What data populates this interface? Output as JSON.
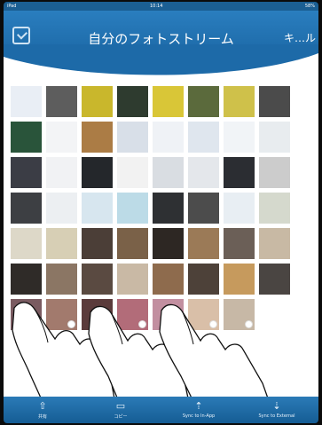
{
  "status_bar": {
    "carrier": "iPad",
    "time": "10:14",
    "battery": "58%"
  },
  "nav": {
    "title": "自分のフォトストリーム",
    "right_label": "キ…ル"
  },
  "thumbnails": [
    [
      "#e9eef5",
      "#5d5d5d",
      "#c9b72c",
      "#2e3b2f",
      "#d9c637",
      "#5b6a3c",
      "#cfc14a",
      "#4b4b4b"
    ],
    [
      "#29543a",
      "#f3f4f6",
      "#ab7c45",
      "#d8dfe8",
      "#eff2f6",
      "#dfe6ee",
      "#f1f4f7",
      "#e8ecef"
    ],
    [
      "#3b3d45",
      "#f1f2f4",
      "#24272b",
      "#f2f2f2",
      "#d9dde2",
      "#e4e7eb",
      "#2b2d32",
      "#cccccc"
    ],
    [
      "#3d3f43",
      "#eceff2",
      "#d7e6ef",
      "#bcdbe7",
      "#2e3033",
      "#4c4c4c",
      "#e8eef3",
      "#d5d9cd"
    ],
    [
      "#ddd8c8",
      "#d7cfb5",
      "#4b3e37",
      "#7a6148",
      "#2d2723",
      "#9b7a57",
      "#6b5f57",
      "#c8b9a4"
    ],
    [
      "#2f2b28",
      "#8b7664",
      "#5a4a41",
      "#c9b9a5",
      "#8e6b4d",
      "#4d4139",
      "#c69a5d",
      "#4a4542"
    ],
    [
      "#7a5b61",
      "#a27a6d",
      "#5b3b3b",
      "#b26c79",
      "#c28fa0",
      "#d9bfa8",
      "#c7b8a6",
      "#ffffff"
    ]
  ],
  "tabs": [
    {
      "label": "共有",
      "icon": "share-icon"
    },
    {
      "label": "コピー",
      "icon": "folder-icon"
    },
    {
      "label": "Sync to In-App",
      "icon": "sync-in-app-icon"
    },
    {
      "label": "Sync to External",
      "icon": "sync-external-icon"
    }
  ],
  "colors": {
    "accent": "#1d6aa8",
    "tabbar": "#155d94"
  }
}
